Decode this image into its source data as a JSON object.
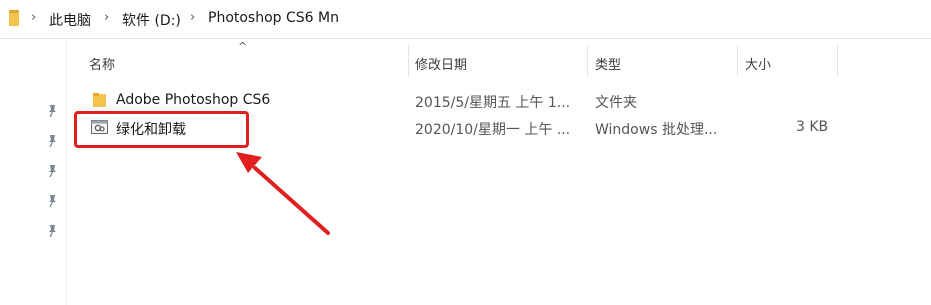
{
  "breadcrumb": {
    "items": [
      "此电脑",
      "软件 (D:)",
      "Photoshop  CS6 Mn"
    ]
  },
  "columns": {
    "name": "名称",
    "date": "修改日期",
    "type": "类型",
    "size": "大小"
  },
  "files": [
    {
      "name": "Adobe Photoshop CS6",
      "date": "2015/5/星期五 上午 1...",
      "type": "文件夹",
      "size": "",
      "icon": "folder-icon"
    },
    {
      "name": "绿化和卸载",
      "date": "2020/10/星期一 上午 ...",
      "type": "Windows 批处理...",
      "size": "3 KB",
      "icon": "batch-file-icon"
    }
  ],
  "colors": {
    "folder": "#f4c34d",
    "annotation": "#e21f1f"
  }
}
